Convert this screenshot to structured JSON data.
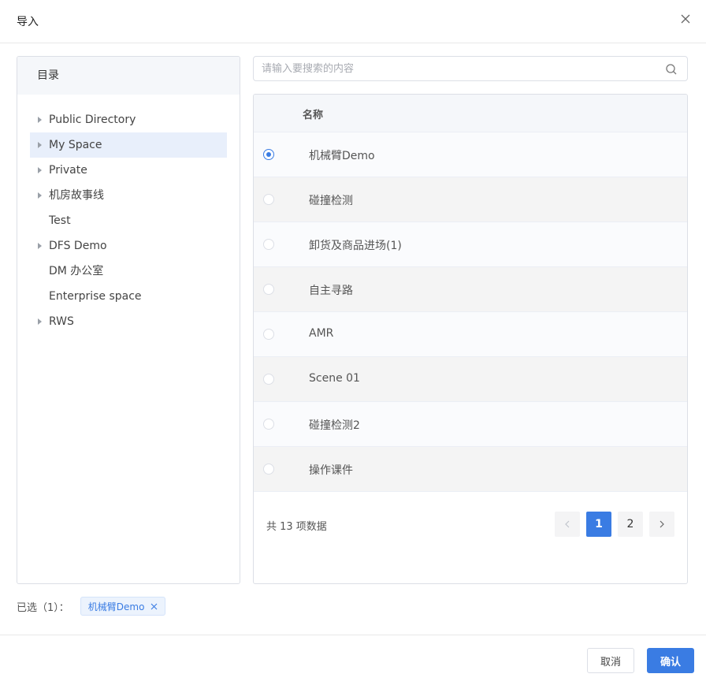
{
  "dialog": {
    "title": "导入"
  },
  "directory": {
    "heading": "目录",
    "items": [
      {
        "label": "Public Directory",
        "expandable": true,
        "selected": false
      },
      {
        "label": "My Space",
        "expandable": true,
        "selected": true
      },
      {
        "label": "Private",
        "expandable": true,
        "selected": false
      },
      {
        "label": "机房故事线",
        "expandable": true,
        "selected": false
      },
      {
        "label": "Test",
        "expandable": false,
        "selected": false
      },
      {
        "label": "DFS Demo",
        "expandable": true,
        "selected": false
      },
      {
        "label": "DM 办公室",
        "expandable": false,
        "selected": false
      },
      {
        "label": "Enterprise space",
        "expandable": false,
        "selected": false
      },
      {
        "label": "RWS",
        "expandable": true,
        "selected": false
      }
    ]
  },
  "search": {
    "placeholder": "请输入要搜索的内容",
    "value": ""
  },
  "table": {
    "column_header": "名称",
    "rows": [
      {
        "name": "机械臂Demo",
        "checked": true
      },
      {
        "name": "碰撞检测",
        "checked": false
      },
      {
        "name": "卸货及商品进场(1)",
        "checked": false
      },
      {
        "name": "自主寻路",
        "checked": false
      },
      {
        "name": "AMR",
        "checked": false
      },
      {
        "name": "Scene 01",
        "checked": false
      },
      {
        "name": "碰撞检测2",
        "checked": false
      },
      {
        "name": "操作课件",
        "checked": false
      }
    ]
  },
  "pagination": {
    "total_text": "共 13 项数据",
    "pages": [
      "1",
      "2"
    ],
    "current": "1"
  },
  "selection": {
    "label": "已选（1）：",
    "tags": [
      "机械臂Demo"
    ]
  },
  "actions": {
    "cancel": "取消",
    "confirm": "确认"
  },
  "colors": {
    "accent": "#3a7ce3",
    "border": "#dcdfe6",
    "header_bg": "#f5f7fa",
    "selected_node_bg": "#e8effb"
  },
  "icons": {
    "close": "close-icon",
    "search": "search-icon",
    "prev": "chevron-left-icon",
    "next": "chevron-right-icon",
    "expand": "caret-right-icon"
  }
}
